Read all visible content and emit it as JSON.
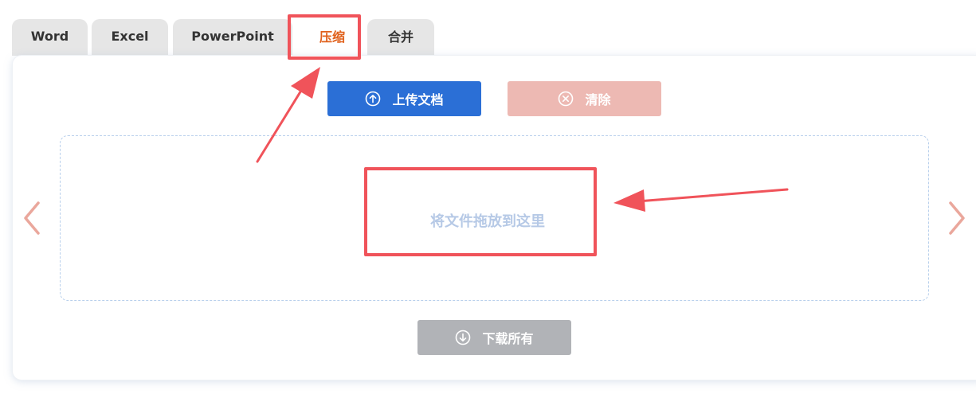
{
  "tabs": [
    {
      "label": "Word",
      "active": false
    },
    {
      "label": "Excel",
      "active": false
    },
    {
      "label": "PowerPoint",
      "active": false
    },
    {
      "label": "压缩",
      "active": true
    },
    {
      "label": "合并",
      "active": false
    }
  ],
  "toolbar": {
    "upload_label": "上传文档",
    "upload_icon": "upload-circle-icon",
    "clear_label": "清除",
    "clear_icon": "close-circle-icon"
  },
  "dropzone": {
    "placeholder": "将文件拖放到这里"
  },
  "download": {
    "label": "下载所有",
    "icon": "download-circle-icon"
  },
  "carousel": {
    "prev_icon": "chevron-left-icon",
    "next_icon": "chevron-right-icon"
  },
  "colors": {
    "primary": "#2b6fd6",
    "clear": "#edb9b3",
    "download": "#b1b3b7",
    "active_tab_text": "#e0611c",
    "annotation": "#f0535a",
    "dropzone_border": "#b9d0ec",
    "arrow": "#eaa79c"
  }
}
